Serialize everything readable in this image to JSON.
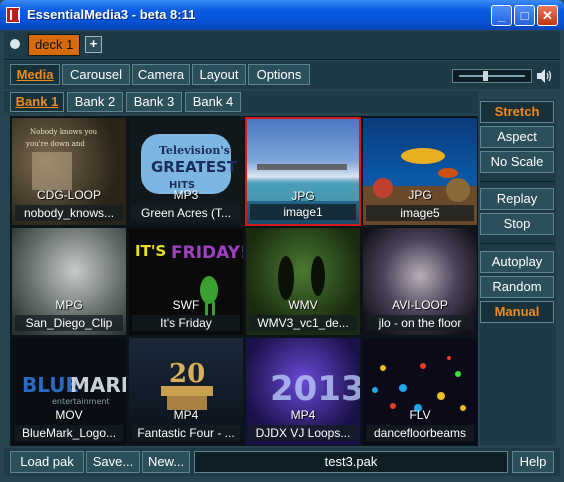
{
  "window": {
    "title": "EssentialMedia3 - beta 8:11",
    "controls": {
      "minimize": "_",
      "maximize": "□",
      "close": "✕"
    }
  },
  "deckbar": {
    "deck_label": "deck 1",
    "add_label": "+"
  },
  "menu": {
    "tabs": [
      "Media",
      "Carousel",
      "Camera",
      "Layout",
      "Options"
    ],
    "active": "Media"
  },
  "volume": {
    "level": 0.4,
    "icon": "speaker-icon"
  },
  "banks": {
    "tabs": [
      "Bank 1",
      "Bank 2",
      "Bank 3",
      "Bank 4"
    ],
    "active": "Bank 1"
  },
  "tiles": [
    {
      "type": "CDG-LOOP",
      "name": "nobody_knows..."
    },
    {
      "type": "MP3",
      "name": "Green Acres (T..."
    },
    {
      "type": "JPG",
      "name": "image1",
      "selected": true
    },
    {
      "type": "JPG",
      "name": "image5"
    },
    {
      "type": "MPG",
      "name": "San_Diego_Clip"
    },
    {
      "type": "SWF",
      "name": "It's Friday"
    },
    {
      "type": "WMV",
      "name": "WMV3_vc1_de..."
    },
    {
      "type": "AVI-LOOP",
      "name": "jlo - on the floor"
    },
    {
      "type": "MOV",
      "name": "BlueMark_Logo..."
    },
    {
      "type": "MP4",
      "name": "Fantastic Four - ..."
    },
    {
      "type": "MP4",
      "name": "DJDX VJ Loops..."
    },
    {
      "type": "FLV",
      "name": "dancefloorbeams"
    }
  ],
  "side": {
    "stretch": "Stretch",
    "aspect": "Aspect",
    "noscale": "No Scale",
    "replay": "Replay",
    "stop": "Stop",
    "autoplay": "Autoplay",
    "random": "Random",
    "manual": "Manual"
  },
  "bottom": {
    "load": "Load pak",
    "save": "Save...",
    "new": "New...",
    "pak": "test3.pak",
    "help": "Help"
  },
  "colors": {
    "accent": "#f08a1e",
    "panel": "#1e3a45",
    "title": "#0553d6",
    "selected_border": "#d11a1a"
  }
}
